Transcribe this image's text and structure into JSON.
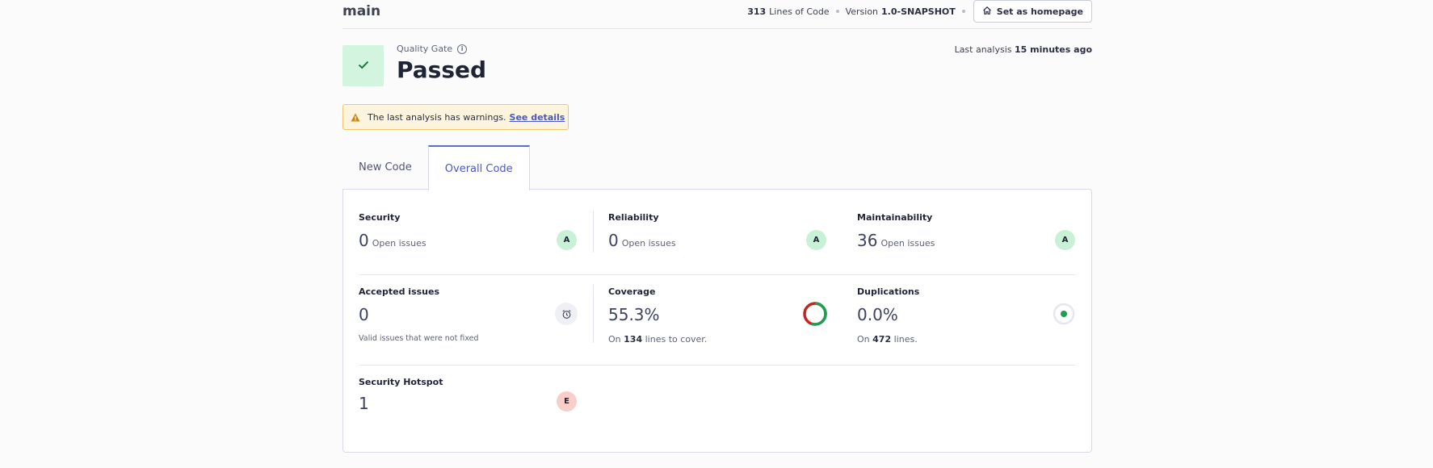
{
  "header": {
    "branch": "main",
    "lines_of_code_value": "313",
    "lines_of_code_label": "Lines of Code",
    "version_label": "Version",
    "version_value": "1.0-SNAPSHOT",
    "homepage_button": "Set as homepage"
  },
  "quality_gate": {
    "label": "Quality Gate",
    "status": "Passed",
    "last_analysis_label": "Last analysis",
    "last_analysis_value": "15 minutes ago"
  },
  "warning": {
    "text": "The last analysis has warnings.",
    "link": "See details"
  },
  "tabs": [
    {
      "label": "New Code",
      "active": false
    },
    {
      "label": "Overall Code",
      "active": true
    }
  ],
  "metrics": {
    "security": {
      "title": "Security",
      "value": "0",
      "sub": "Open issues",
      "rating": "A"
    },
    "reliability": {
      "title": "Reliability",
      "value": "0",
      "sub": "Open issues",
      "rating": "A"
    },
    "maintainability": {
      "title": "Maintainability",
      "value": "36",
      "sub": "Open issues",
      "rating": "A"
    },
    "accepted": {
      "title": "Accepted issues",
      "value": "0",
      "note": "Valid issues that were not fixed"
    },
    "coverage": {
      "title": "Coverage",
      "value": "55.3%",
      "on_prefix": "On",
      "on_value": "134",
      "on_suffix": "lines to cover.",
      "percent": 55.3
    },
    "duplications": {
      "title": "Duplications",
      "value": "0.0%",
      "on_prefix": "On",
      "on_value": "472",
      "on_suffix": "lines."
    },
    "hotspot": {
      "title": "Security Hotspot",
      "value": "1",
      "rating": "E"
    }
  },
  "colors": {
    "accent": "#5d6bcf",
    "pass_bg": "#d3f5df",
    "pass_check": "#1f7a3e",
    "rating_a": "#c9f1d6",
    "rating_e": "#f9cdc9",
    "coverage_good": "#1e9e54",
    "coverage_bad": "#c2261f"
  }
}
